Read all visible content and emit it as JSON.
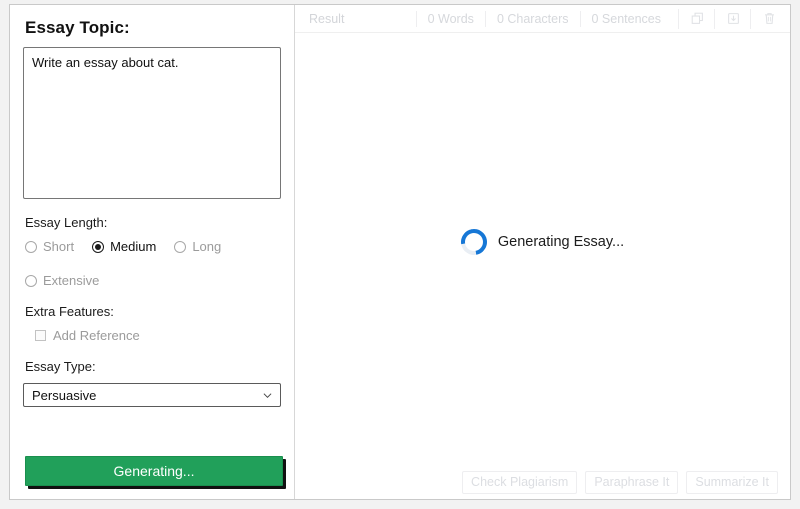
{
  "left": {
    "title": "Essay Topic:",
    "topic_value": "Write an essay about cat.",
    "topic_placeholder": "",
    "length_label": "Essay Length:",
    "length_options": [
      {
        "label": "Short",
        "selected": false,
        "disabled": true
      },
      {
        "label": "Medium",
        "selected": true,
        "disabled": false
      },
      {
        "label": "Long",
        "selected": false,
        "disabled": true
      },
      {
        "label": "Extensive",
        "selected": false,
        "disabled": true
      }
    ],
    "extra_label": "Extra Features:",
    "extra_options": [
      {
        "label": "Add Reference",
        "checked": false,
        "disabled": true
      }
    ],
    "type_label": "Essay Type:",
    "type_value": "Persuasive",
    "submit_label": "Generating..."
  },
  "right": {
    "result_label": "Result",
    "metrics": [
      {
        "label": "0 Words"
      },
      {
        "label": "0 Characters"
      },
      {
        "label": "0 Sentences"
      }
    ],
    "icons": [
      {
        "name": "copy-icon"
      },
      {
        "name": "download-icon"
      },
      {
        "name": "trash-icon"
      }
    ],
    "loading_text": "Generating Essay...",
    "footer_buttons": [
      {
        "label": "Check Plagiarism"
      },
      {
        "label": "Paraphrase It"
      },
      {
        "label": "Summarize It"
      }
    ]
  },
  "colors": {
    "accent_green": "#21a05a",
    "spinner_blue": "#1677d6",
    "disabled_gray": "#9b9b9b",
    "muted_gray": "#d6d8dc"
  }
}
